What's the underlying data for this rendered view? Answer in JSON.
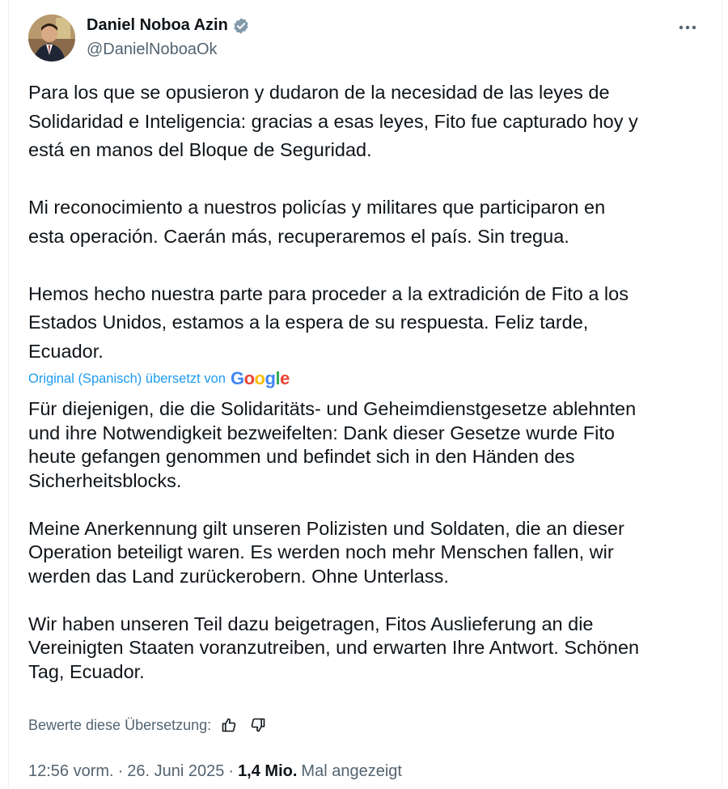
{
  "author": {
    "display_name": "Daniel Noboa Azin",
    "handle": "@DanielNoboaOk",
    "verified_icon": "verified-badge-icon",
    "avatar_icon": "profile-photo"
  },
  "menu": {
    "icon": "more-horizontal-icon"
  },
  "original_text": {
    "paragraphs": [
      [
        "Para los que se opusieron y dudaron de la necesidad de las leyes de",
        "Solidaridad e Inteligencia: gracias a esas leyes, Fito fue capturado hoy y",
        "está en manos del Bloque de Seguridad."
      ],
      [
        "Mi reconocimiento a nuestros policías y militares que participaron en",
        "esta operación. Caerán más, recuperaremos el país. Sin tregua."
      ],
      [
        "Hemos hecho nuestra parte para proceder a la extradición de Fito a los",
        "Estados Unidos, estamos a la espera de su respuesta. Feliz tarde,",
        "Ecuador."
      ]
    ]
  },
  "translation": {
    "label": "Original (Spanisch) übersetzt von",
    "provider": "Google",
    "paragraphs": [
      [
        "Für diejenigen, die die Solidaritäts- und Geheimdienstgesetze ablehnten",
        "und ihre Notwendigkeit bezweifelten: Dank dieser Gesetze wurde Fito",
        "heute gefangen genommen und befindet sich in den Händen des",
        "Sicherheitsblocks."
      ],
      [
        "Meine Anerkennung gilt unseren Polizisten und Soldaten, die an dieser",
        "Operation beteiligt waren. Es werden noch mehr Menschen fallen, wir",
        "werden das Land zurückerobern. Ohne Unterlass."
      ],
      [
        "Wir haben unseren Teil dazu beigetragen, Fitos Auslieferung an die",
        "Vereinigten Staaten voranzutreiben, und erwarten Ihre Antwort. Schönen",
        "Tag, Ecuador."
      ]
    ],
    "rate_label": "Bewerte diese Übersetzung:",
    "thumbs_up_icon": "thumbs-up-icon",
    "thumbs_down_icon": "thumbs-down-icon"
  },
  "meta": {
    "time": "12:56 vorm.",
    "separator": "·",
    "date": "26. Juni 2025",
    "views": "1,4 Mio.",
    "views_label": "Mal angezeigt"
  },
  "colors": {
    "text": "#0f1419",
    "secondary": "#536471",
    "accent": "#1d9bf0",
    "verified": "#829aab"
  }
}
